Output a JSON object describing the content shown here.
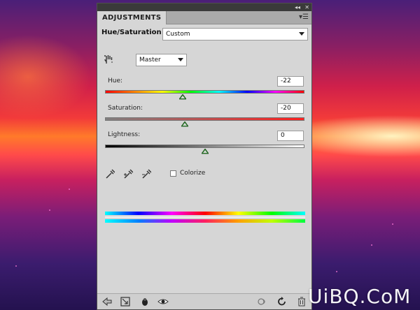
{
  "panel": {
    "tab_label": "ADJUSTMENTS",
    "title": "Hue/Saturation",
    "preset": {
      "selected": "Custom"
    },
    "channel": {
      "selected": "Master"
    },
    "hue": {
      "label": "Hue:",
      "value": "-22",
      "slider_fraction": 0.39
    },
    "saturation": {
      "label": "Saturation:",
      "value": "-20",
      "slider_fraction": 0.4
    },
    "lightness": {
      "label": "Lightness:",
      "value": "0",
      "slider_fraction": 0.5
    },
    "colorize": {
      "label": "Colorize",
      "checked": false
    }
  },
  "watermark": "UiBQ.CoM",
  "colors": {
    "panel_bg": "#d6d6d6",
    "titlebar": "#3a3a3a",
    "thumb": "#2f8a2f"
  }
}
